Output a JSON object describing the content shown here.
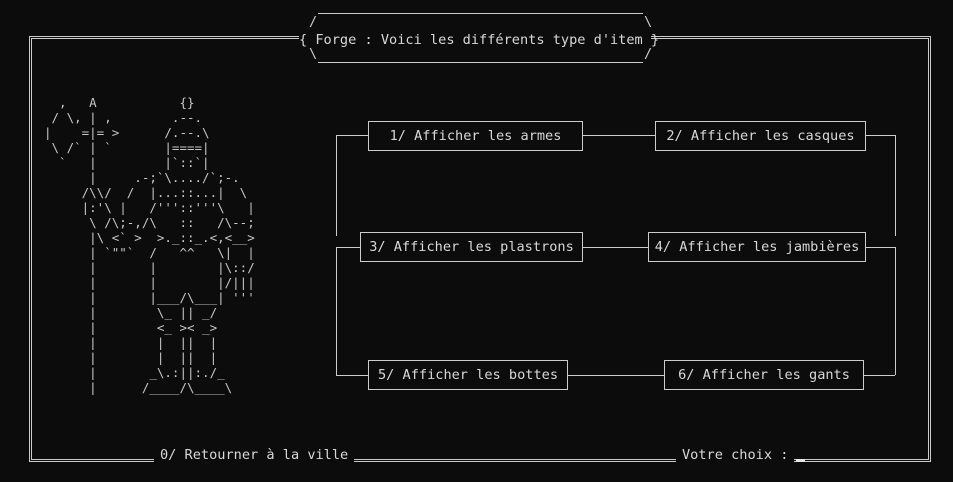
{
  "header": {
    "title": "{ Forge : Voici les différents type d'item }"
  },
  "ascii_art": {
    "lines": [
      "  ,   A           {}",
      " / \\, | ,        .--.",
      "|    =|= >      /.--.\\",
      " \\ /` | `       |====|",
      "  `   |         |`::`|",
      "      |     .-;`\\..../`;-.",
      "     /\\\\/  /  |...::...|  \\",
      "     |:'\\ |   /'''::'''\\   |",
      "      \\ /\\;-,/\\   ::   /\\--;",
      "      |\\ <` >  >._::_.<,<__>",
      "      | `\"\"`  /   ^^   \\|  |",
      "      |       |        |\\::/",
      "      |       |        |/|||",
      "      |       |___/\\___| '''",
      "      |        \\_ || _/",
      "      |        <_ >< _>",
      "      |        |  ||  |",
      "      |        |  ||  |",
      "      |       _\\.:||:./_",
      "      |      /____/\\____\\"
    ]
  },
  "menu": {
    "items": [
      {
        "label": "1/ Afficher les armes"
      },
      {
        "label": "2/ Afficher les casques"
      },
      {
        "label": "3/ Afficher les plastrons"
      },
      {
        "label": "4/ Afficher les jambières"
      },
      {
        "label": "5/ Afficher les bottes"
      },
      {
        "label": "6/ Afficher les gants"
      }
    ]
  },
  "footer": {
    "back_label": "0/ Retourner à la ville",
    "prompt_label": "Votre choix :"
  },
  "colors": {
    "background": "#0c0c0c",
    "foreground": "#cccccc"
  }
}
